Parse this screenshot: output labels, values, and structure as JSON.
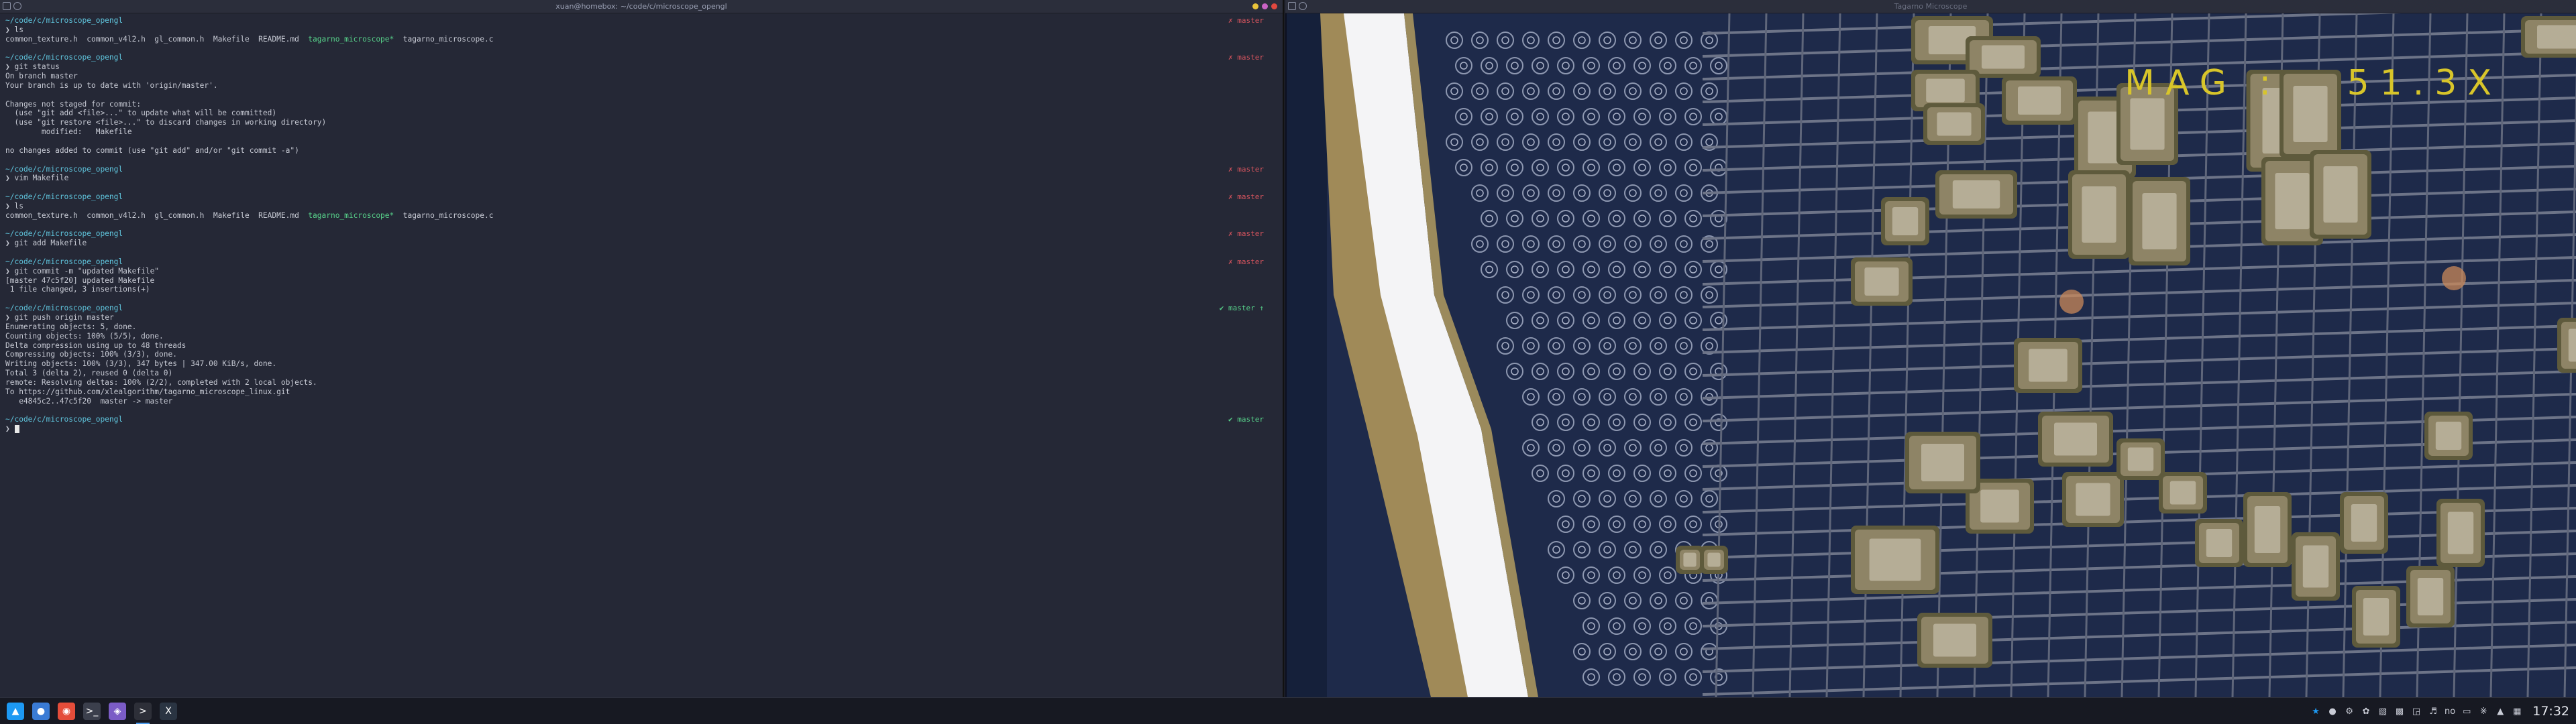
{
  "terminal": {
    "title": "xuan@homebox: ~/code/c/microscope_opengl",
    "lines": [
      {
        "kind": "cwd",
        "text": "~/code/c/microscope_opengl",
        "git": "✗ master",
        "git_state": "dirty"
      },
      {
        "kind": "cmd",
        "text": "ls"
      },
      {
        "kind": "ls",
        "parts": [
          "common_texture.h  common_v4l2.h  gl_common.h  Makefile  README.md  ",
          "tagarno_microscope*",
          "  tagarno_microscope.c"
        ]
      },
      {
        "kind": "gap"
      },
      {
        "kind": "cwd",
        "text": "~/code/c/microscope_opengl",
        "git": "✗ master",
        "git_state": "dirty"
      },
      {
        "kind": "cmd",
        "text": "git status"
      },
      {
        "kind": "out",
        "text": "On branch master"
      },
      {
        "kind": "out",
        "text": "Your branch is up to date with 'origin/master'."
      },
      {
        "kind": "gap"
      },
      {
        "kind": "out",
        "text": "Changes not staged for commit:"
      },
      {
        "kind": "out",
        "text": "  (use \"git add <file>...\" to update what will be committed)"
      },
      {
        "kind": "out",
        "text": "  (use \"git restore <file>...\" to discard changes in working directory)"
      },
      {
        "kind": "out",
        "text": "        modified:   Makefile"
      },
      {
        "kind": "gap"
      },
      {
        "kind": "out",
        "text": "no changes added to commit (use \"git add\" and/or \"git commit -a\")"
      },
      {
        "kind": "gap"
      },
      {
        "kind": "cwd",
        "text": "~/code/c/microscope_opengl",
        "git": "✗ master",
        "git_state": "dirty"
      },
      {
        "kind": "cmd",
        "text": "vim Makefile"
      },
      {
        "kind": "gap"
      },
      {
        "kind": "cwd",
        "text": "~/code/c/microscope_opengl",
        "git": "✗ master",
        "git_state": "dirty"
      },
      {
        "kind": "cmd",
        "text": "ls"
      },
      {
        "kind": "ls",
        "parts": [
          "common_texture.h  common_v4l2.h  gl_common.h  Makefile  README.md  ",
          "tagarno_microscope*",
          "  tagarno_microscope.c"
        ]
      },
      {
        "kind": "gap"
      },
      {
        "kind": "cwd",
        "text": "~/code/c/microscope_opengl",
        "git": "✗ master",
        "git_state": "dirty"
      },
      {
        "kind": "cmd",
        "text": "git add Makefile"
      },
      {
        "kind": "gap"
      },
      {
        "kind": "cwd",
        "text": "~/code/c/microscope_opengl",
        "git": "✗ master",
        "git_state": "dirty"
      },
      {
        "kind": "cmd",
        "text": "git commit -m \"updated Makefile\""
      },
      {
        "kind": "out",
        "text": "[master 47c5f20] updated Makefile"
      },
      {
        "kind": "out",
        "text": " 1 file changed, 3 insertions(+)"
      },
      {
        "kind": "gap"
      },
      {
        "kind": "cwd",
        "text": "~/code/c/microscope_opengl",
        "git": "✔ master ↑",
        "git_state": "clean"
      },
      {
        "kind": "cmd",
        "text": "git push origin master"
      },
      {
        "kind": "out",
        "text": "Enumerating objects: 5, done."
      },
      {
        "kind": "out",
        "text": "Counting objects: 100% (5/5), done."
      },
      {
        "kind": "out",
        "text": "Delta compression using up to 48 threads"
      },
      {
        "kind": "out",
        "text": "Compressing objects: 100% (3/3), done."
      },
      {
        "kind": "out",
        "text": "Writing objects: 100% (3/3), 347 bytes | 347.00 KiB/s, done."
      },
      {
        "kind": "out",
        "text": "Total 3 (delta 2), reused 0 (delta 0)"
      },
      {
        "kind": "out",
        "text": "remote: Resolving deltas: 100% (2/2), completed with 2 local objects."
      },
      {
        "kind": "out",
        "text": "To https://github.com/xlealgorithm/tagarno_microscope_linux.git"
      },
      {
        "kind": "out",
        "text": "   e4845c2..47c5f20  master -> master"
      },
      {
        "kind": "gap"
      },
      {
        "kind": "cwd",
        "text": "~/code/c/microscope_opengl",
        "git": "✔ master",
        "git_state": "clean"
      },
      {
        "kind": "prompt"
      }
    ],
    "prompt_symbol": "❯"
  },
  "microscope": {
    "title": "Tagarno Microscope",
    "overlay": "MAG :   51.3X",
    "overlay_color": "#d8c52a"
  },
  "taskbar": {
    "apps": [
      {
        "name": "kde-menu-icon",
        "glyph": "▲",
        "color": "#1d99f3"
      },
      {
        "name": "browser-globe-icon",
        "glyph": "●",
        "color": "#3a7bd5"
      },
      {
        "name": "chrome-icon",
        "glyph": "◉",
        "color": "#e44d3a"
      },
      {
        "name": "terminal-app-icon",
        "glyph": ">_",
        "color": "#3b3f4c"
      },
      {
        "name": "github-desktop-icon",
        "glyph": "◈",
        "color": "#7b5cc6"
      },
      {
        "name": "konsole-icon",
        "glyph": ">",
        "color": "#2d2f38"
      },
      {
        "name": "x-app-icon",
        "glyph": "X",
        "color": "#2a3442"
      }
    ],
    "keyboard_layout": "no",
    "clock": "17:32"
  },
  "colors": {
    "terminal_bg": "#252836",
    "cwd": "#5fc4dc",
    "git_dirty": "#d2535d",
    "git_clean": "#57d18a",
    "executable": "#57d18a"
  }
}
